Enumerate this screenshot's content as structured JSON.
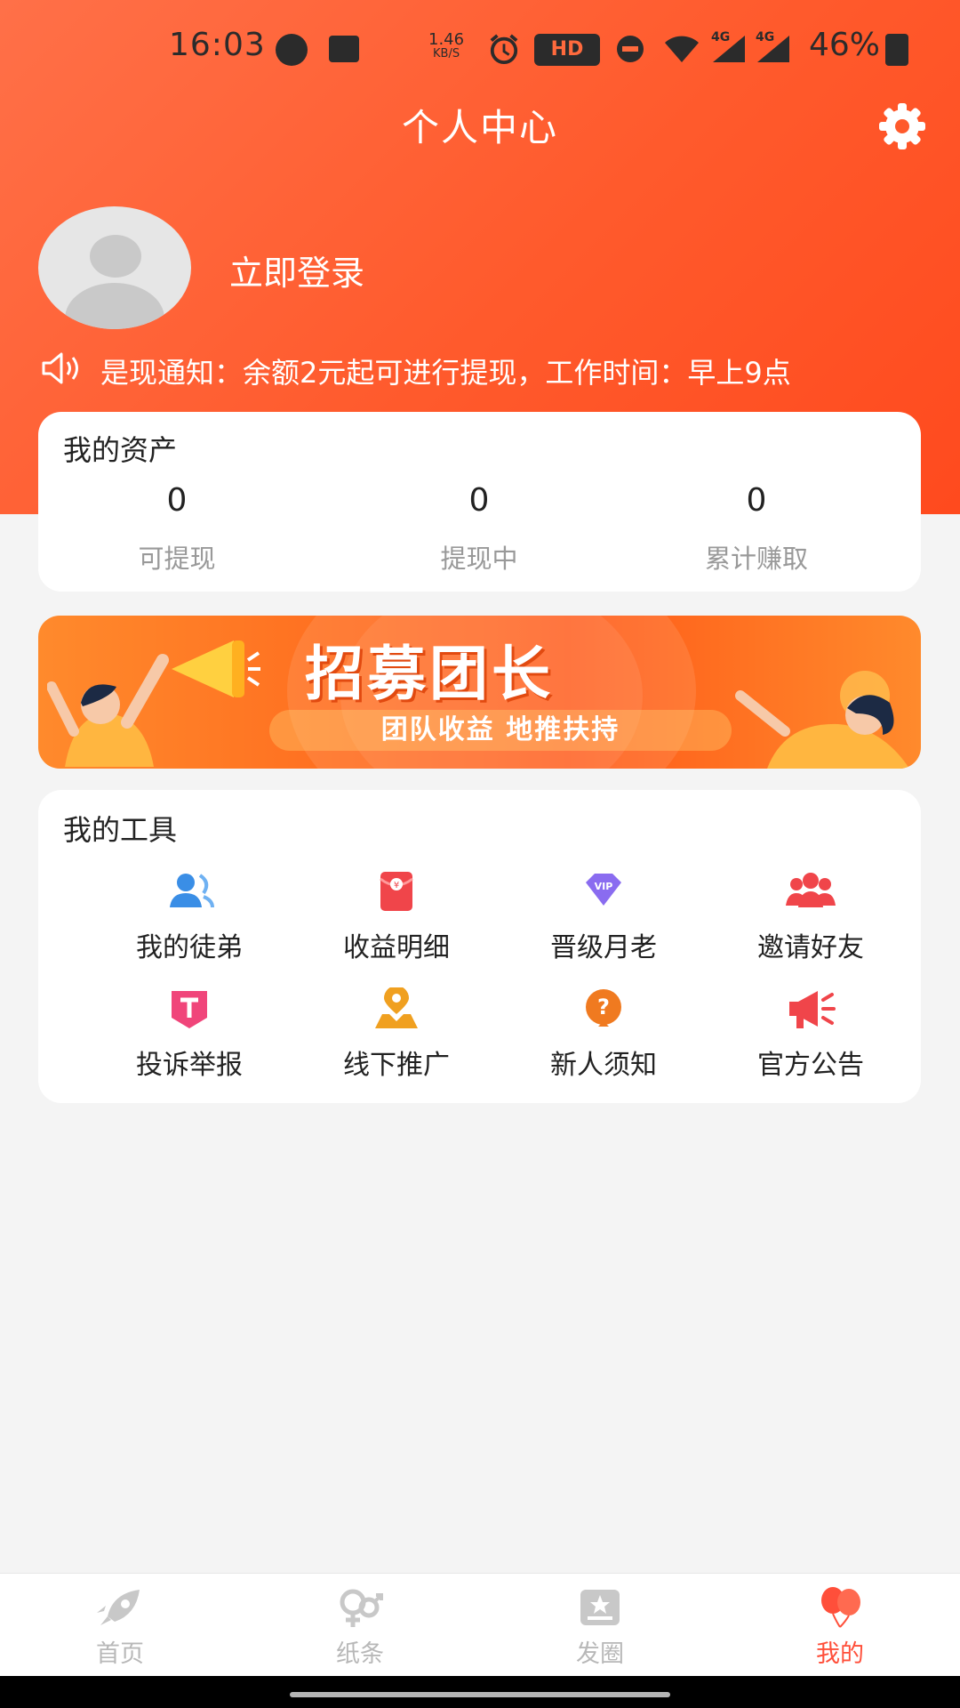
{
  "status_bar": {
    "time": "16:03",
    "speed_value": "1.46",
    "speed_unit": "KB/S",
    "hd_badge": "HD",
    "network_a": "4G",
    "network_b": "4G",
    "battery": "46%"
  },
  "header": {
    "title": "个人中心",
    "settings_icon": "gear-icon"
  },
  "profile": {
    "login_text": "立即登录"
  },
  "notice": {
    "icon": "speaker-icon",
    "text": "是现通知：余额2元起可进行提现，工作时间：早上9点"
  },
  "assets": {
    "title": "我的资产",
    "items": [
      {
        "value": "0",
        "label": "可提现"
      },
      {
        "value": "0",
        "label": "提现中"
      },
      {
        "value": "0",
        "label": "累计赚取"
      }
    ]
  },
  "banner": {
    "title": "招募团长",
    "subtitle": "团队收益 地推扶持"
  },
  "tools": {
    "title": "我的工具",
    "items": [
      {
        "label": "我的徒弟",
        "icon": "disciples-icon",
        "color": "#3a8ee6"
      },
      {
        "label": "收益明细",
        "icon": "red-envelope-icon",
        "color": "#f0454a"
      },
      {
        "label": "晋级月老",
        "icon": "vip-icon",
        "color": "#8a6cf0"
      },
      {
        "label": "邀请好友",
        "icon": "invite-friends-icon",
        "color": "#f0454a"
      },
      {
        "label": "投诉举报",
        "icon": "complaint-icon",
        "color": "#f0457a"
      },
      {
        "label": "线下推广",
        "icon": "location-icon",
        "color": "#f0a020"
      },
      {
        "label": "新人须知",
        "icon": "question-icon",
        "color": "#f07a20"
      },
      {
        "label": "官方公告",
        "icon": "megaphone-icon",
        "color": "#f0454a"
      }
    ]
  },
  "bottom_nav": {
    "items": [
      {
        "label": "首页",
        "icon": "rocket-icon",
        "active": false
      },
      {
        "label": "纸条",
        "icon": "note-icon",
        "active": false
      },
      {
        "label": "发圈",
        "icon": "post-icon",
        "active": false
      },
      {
        "label": "我的",
        "icon": "balloons-icon",
        "active": true
      }
    ]
  },
  "colors": {
    "header_gradient_start": "#ff7048",
    "header_gradient_end": "#ff4a1e",
    "active_tab": "#ff4f3a",
    "inactive_tab": "#b8b8b8"
  }
}
